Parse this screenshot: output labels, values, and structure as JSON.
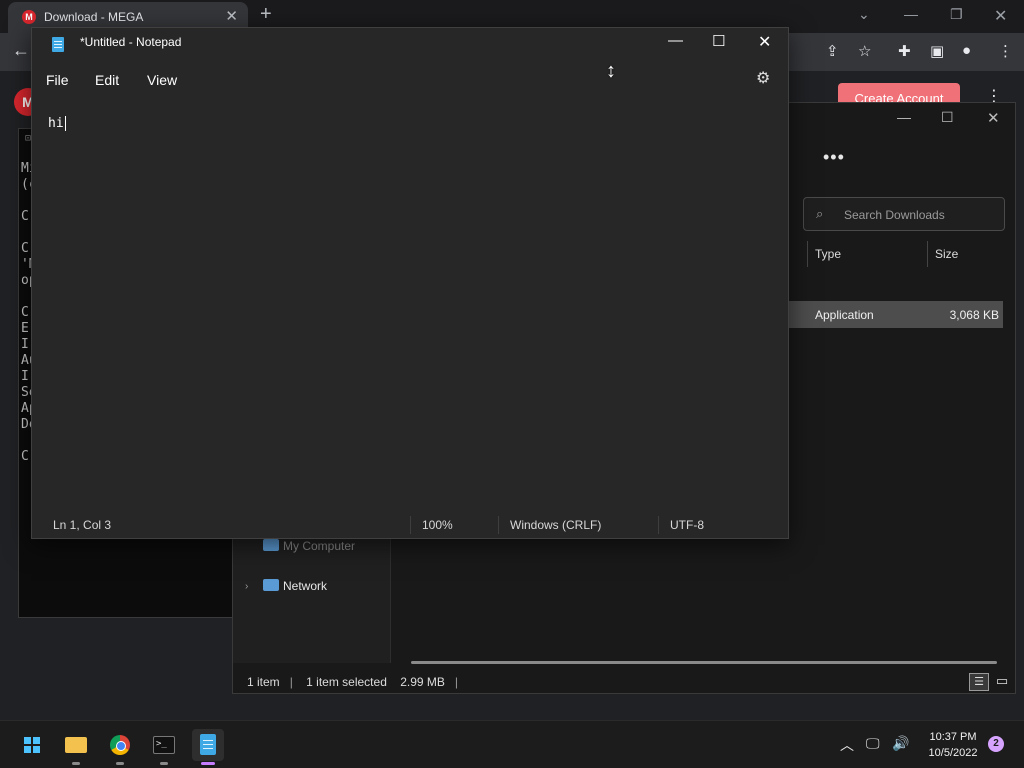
{
  "browser": {
    "tab_title": "Download - MEGA",
    "favicon_letter": "M",
    "close_tab": "✕",
    "new_tab": "+",
    "create_account": "Create Account",
    "mega_logo": "M"
  },
  "terminal": {
    "lines": [
      "Mi",
      "(c",
      "",
      "C:",
      "",
      "C:",
      "'M",
      "op",
      "",
      "C:",
      "Er",
      "Ir",
      "Au",
      "Ir",
      "Se",
      "Ap",
      "Do",
      "",
      "C:"
    ]
  },
  "explorer": {
    "more": "•••",
    "search_placeholder": "Search Downloads",
    "columns": {
      "type": "Type",
      "size": "Size"
    },
    "row": {
      "type": "Application",
      "size": "3,068 KB"
    },
    "nav": {
      "my_computer": "My Computer",
      "network": "Network"
    },
    "status": {
      "count": "1 item",
      "selected": "1 item selected",
      "selected_size": "2.99 MB"
    }
  },
  "notepad": {
    "title": "*Untitled - Notepad",
    "menus": {
      "file": "File",
      "edit": "Edit",
      "view": "View"
    },
    "content": "hi",
    "status": {
      "position": "Ln 1, Col 3",
      "zoom": "100%",
      "line_ending": "Windows (CRLF)",
      "encoding": "UTF-8"
    }
  },
  "taskbar": {
    "time": "10:37 PM",
    "date": "10/5/2022",
    "notifications": "2"
  },
  "colors": {
    "accent": "#c77dff",
    "mega_red": "#d9272e",
    "notepad_bg": "#272727"
  }
}
